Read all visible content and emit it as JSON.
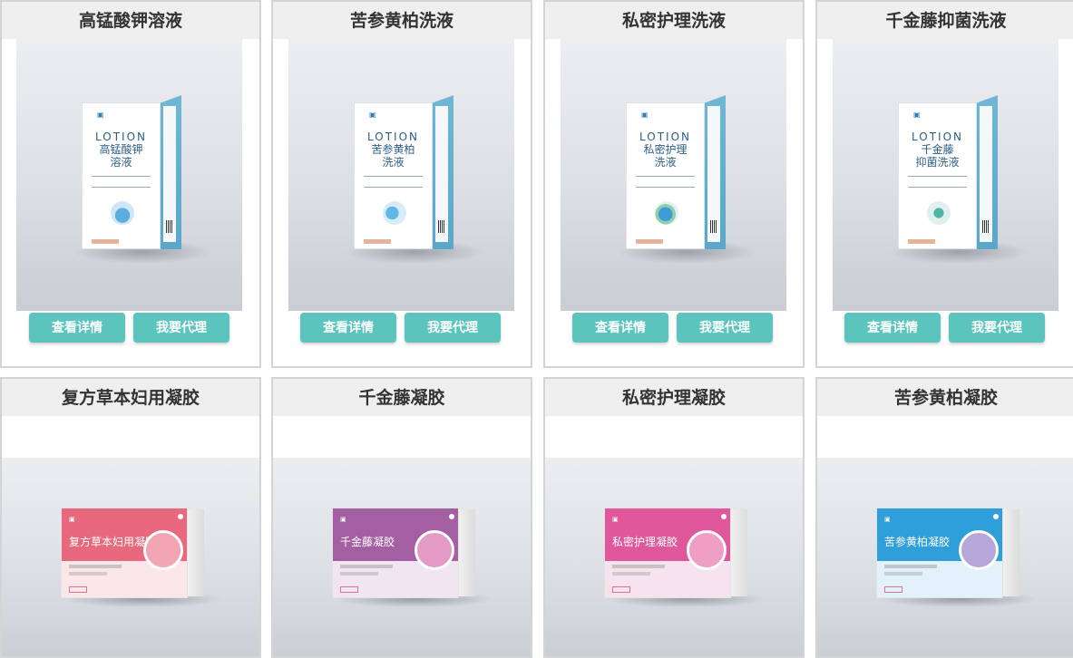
{
  "buttons": {
    "detail": "查看详情",
    "agent": "我要代理"
  },
  "row1": [
    {
      "title": "高锰酸钾溶液",
      "box_word": "LOTION",
      "box_name_1": "高锰酸钾",
      "box_name_2": "溶液",
      "symbol_color": "#5aaee0"
    },
    {
      "title": "苦参黄柏洗液",
      "box_word": "LOTION",
      "box_name_1": "苦参黄柏",
      "box_name_2": "洗液",
      "symbol_color": "#62b6e6"
    },
    {
      "title": "私密护理洗液",
      "box_word": "LOTION",
      "box_name_1": "私密护理",
      "box_name_2": "洗液",
      "symbol_color": "#3f9bd8"
    },
    {
      "title": "千金藤抑菌洗液",
      "box_word": "LOTION",
      "box_name_1": "千金藤",
      "box_name_2": "抑菌洗液",
      "symbol_color": "#4fb3a6"
    }
  ],
  "row2": [
    {
      "title": "复方草本妇用凝胶",
      "box_name": "复方草本妇用凝胶",
      "box_color": "#e8687e",
      "lower_color": "#fbe7ea"
    },
    {
      "title": "千金藤凝胶",
      "box_name": "千金藤凝胶",
      "box_color": "#a45ea2",
      "lower_color": "#f0e5f1"
    },
    {
      "title": "私密护理凝胶",
      "box_name": "私密护理凝胶",
      "box_color": "#e0579b",
      "lower_color": "#f6e3ee"
    },
    {
      "title": "苦参黄柏凝胶",
      "box_name": "苦参黄柏凝胶",
      "box_color": "#2f9fdb",
      "lower_color": "#e2f1fa"
    }
  ]
}
